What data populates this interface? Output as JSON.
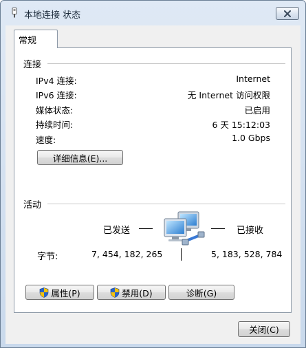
{
  "window": {
    "title": "本地连接 状态",
    "close_glyph": "✕"
  },
  "tabs": [
    {
      "label": "常规",
      "selected": true
    }
  ],
  "connection": {
    "header": "连接",
    "rows": [
      {
        "label": "IPv4 连接:",
        "value": "Internet"
      },
      {
        "label": "IPv6 连接:",
        "value": "无 Internet 访问权限"
      },
      {
        "label": "媒体状态:",
        "value": "已启用"
      },
      {
        "label": "持续时间:",
        "value": "6 天 15:12:03"
      },
      {
        "label": "速度:",
        "value": "1.0 Gbps"
      }
    ],
    "details_button": "详细信息(E)..."
  },
  "activity": {
    "header": "活动",
    "sent_label": "已发送",
    "received_label": "已接收",
    "bytes_label": "字节:",
    "bytes_sent": "7, 454, 182, 265",
    "bytes_received": "5, 183, 528, 784",
    "icon": "network-computers-icon"
  },
  "buttons": {
    "properties": "属性(P)",
    "disable": "禁用(D)",
    "diagnose": "诊断(G)",
    "close": "关闭(C)"
  },
  "colors": {
    "window_frame": "#c9d9ec",
    "client_bg": "#f0f0f0",
    "panel_bg": "#ffffff",
    "shield_blue": "#2a64c8",
    "shield_yellow": "#f4c20d"
  }
}
